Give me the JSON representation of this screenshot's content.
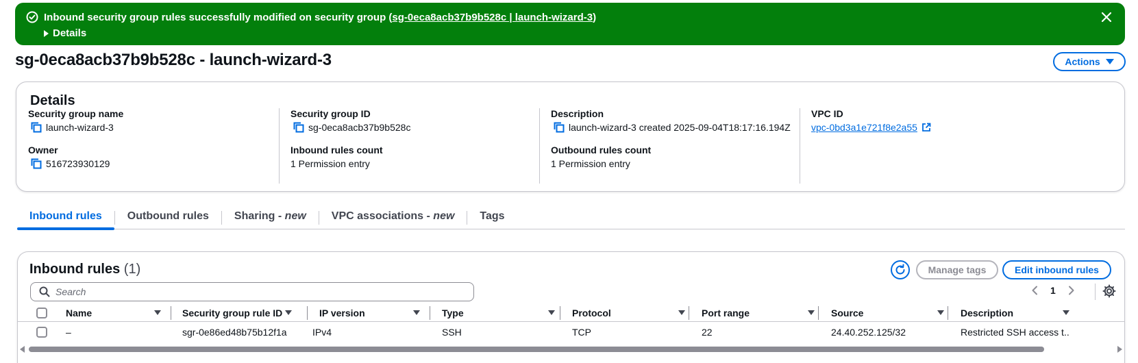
{
  "flash": {
    "message_prefix": "Inbound security group rules successfully modified on security group (",
    "link_text": "sg-0eca8acb37b9b528c | launch-wizard-3",
    "message_suffix": ")",
    "details_label": "Details",
    "icon": "check-circle-icon",
    "background": "#037f0c"
  },
  "header": {
    "title": "sg-0eca8acb37b9b528c - launch-wizard-3",
    "actions_label": "Actions"
  },
  "details": {
    "title": "Details",
    "security_group_name_label": "Security group name",
    "security_group_name": "launch-wizard-3",
    "security_group_id_label": "Security group ID",
    "security_group_id": "sg-0eca8acb37b9b528c",
    "description_label": "Description",
    "description": "launch-wizard-3 created 2025-09-04T18:17:16.194Z",
    "vpc_id_label": "VPC ID",
    "vpc_id": "vpc-0bd3a1e721f8e2a55",
    "owner_label": "Owner",
    "owner": "516723930129",
    "inbound_rules_count_label": "Inbound rules count",
    "inbound_rules_count": "1 Permission entry",
    "outbound_rules_count_label": "Outbound rules count",
    "outbound_rules_count": "1 Permission entry"
  },
  "tabs": [
    {
      "label": "Inbound rules",
      "suffix": "",
      "active": true
    },
    {
      "label": "Outbound rules",
      "suffix": "",
      "active": false
    },
    {
      "label": "Sharing - ",
      "suffix": "new",
      "active": false
    },
    {
      "label": "VPC associations - ",
      "suffix": "new",
      "active": false
    },
    {
      "label": "Tags",
      "suffix": "",
      "active": false
    }
  ],
  "inbound": {
    "title": "Inbound rules",
    "count": "(1)",
    "manage_tags_label": "Manage tags",
    "edit_label": "Edit inbound rules",
    "search_placeholder": "Search",
    "page": "1",
    "columns": [
      "Name",
      "Security group rule ID",
      "IP version",
      "Type",
      "Protocol",
      "Port range",
      "Source",
      "Description"
    ],
    "rows": [
      {
        "name": "–",
        "rule_id": "sgr-0e86ed48b75b12f1a",
        "ip_version": "IPv4",
        "type": "SSH",
        "protocol": "TCP",
        "port_range": "22",
        "source": "24.40.252.125/32",
        "description": "Restricted SSH access t..."
      }
    ]
  },
  "colors": {
    "accent": "#006ce0",
    "success": "#037f0c",
    "border": "#c6c6cd",
    "text": "#0f141a"
  }
}
